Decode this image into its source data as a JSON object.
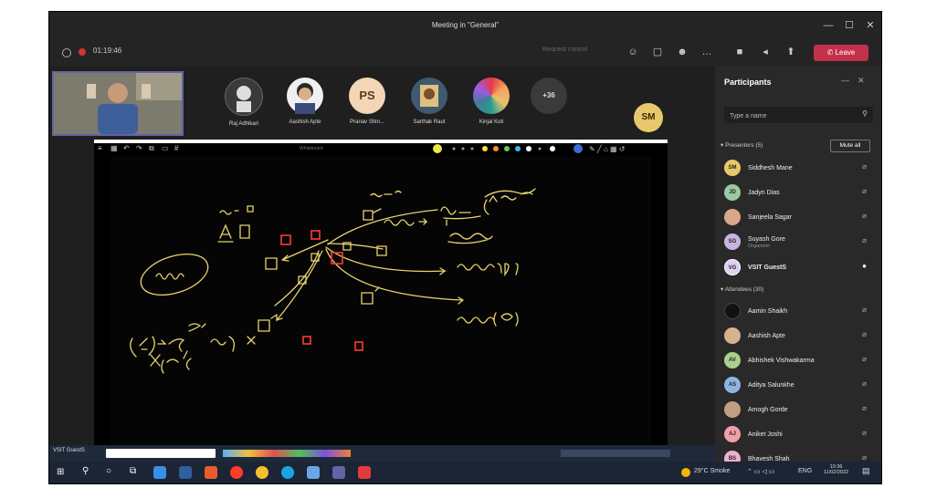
{
  "window": {
    "title": "Meeting in \"General\"",
    "controls": [
      "—",
      "☐",
      "✕"
    ]
  },
  "toolbar": {
    "timer": "01:19:46",
    "request_control": "Request control",
    "leave_label": "Leave",
    "icons": [
      "people-icon",
      "chat-icon",
      "reactions-icon",
      "more-icon",
      "camera-icon",
      "mic-icon",
      "share-icon"
    ]
  },
  "stage": {
    "participants": [
      {
        "initials": "",
        "name": "Raj Adhikari",
        "color": "#3a3a3a"
      },
      {
        "initials": "",
        "name": "Aashish Apte",
        "color": "#f0f0f0"
      },
      {
        "initials": "PS",
        "name": "Pranav Shin...",
        "color": "#f3d6b5"
      },
      {
        "initials": "",
        "name": "Sarthak Raut",
        "color": "#3f5a70"
      },
      {
        "initials": "",
        "name": "Kinjal Koli",
        "color": "#c34ab0"
      },
      {
        "initials": "+36",
        "name": "",
        "color": "#3a3a3a"
      }
    ],
    "speaker_initials": "SM",
    "whiteboard_tab": "Whiteboard"
  },
  "panel": {
    "title": "Participants",
    "search_placeholder": "Type a name",
    "presenters_label": "Presenters (5)",
    "mute_all": "Mute all",
    "attendees_label": "Attendees (30)",
    "presenters": [
      {
        "initials": "SM",
        "name": "Siddhesh Mane",
        "sub": "",
        "color": "#e8c86c"
      },
      {
        "initials": "JD",
        "name": "Jadyn Dias",
        "sub": "",
        "color": "#9bc9a3"
      },
      {
        "initials": "",
        "name": "Sanjeela Sagar",
        "sub": "",
        "color": "#d9a88a"
      },
      {
        "initials": "SG",
        "name": "Suyash Gore",
        "sub": "Organizer",
        "color": "#c9b4e0"
      },
      {
        "initials": "VG",
        "name": "VSIT GuestS",
        "sub": "",
        "color": "#e0d0f0"
      }
    ],
    "attendees": [
      {
        "initials": "",
        "name": "Aamin Shaikh",
        "color": "#111111"
      },
      {
        "initials": "",
        "name": "Aashish Apte",
        "color": "#d7b28f"
      },
      {
        "initials": "AV",
        "name": "Abhishek Vishwakarma",
        "color": "#a9d18e"
      },
      {
        "initials": "AS",
        "name": "Aditya Salunkhe",
        "color": "#8fb4e0"
      },
      {
        "initials": "",
        "name": "Amogh Gorde",
        "color": "#c0a080"
      },
      {
        "initials": "AJ",
        "name": "Aniket Joshi",
        "color": "#f0a0a8"
      },
      {
        "initials": "BS",
        "name": "Bhavesh Shah",
        "color": "#f0b0d0"
      }
    ]
  },
  "taskbar": {
    "weather": "29°C  Smoke",
    "lang": "ENG",
    "time": "10:36",
    "date": "11/02/2022"
  }
}
